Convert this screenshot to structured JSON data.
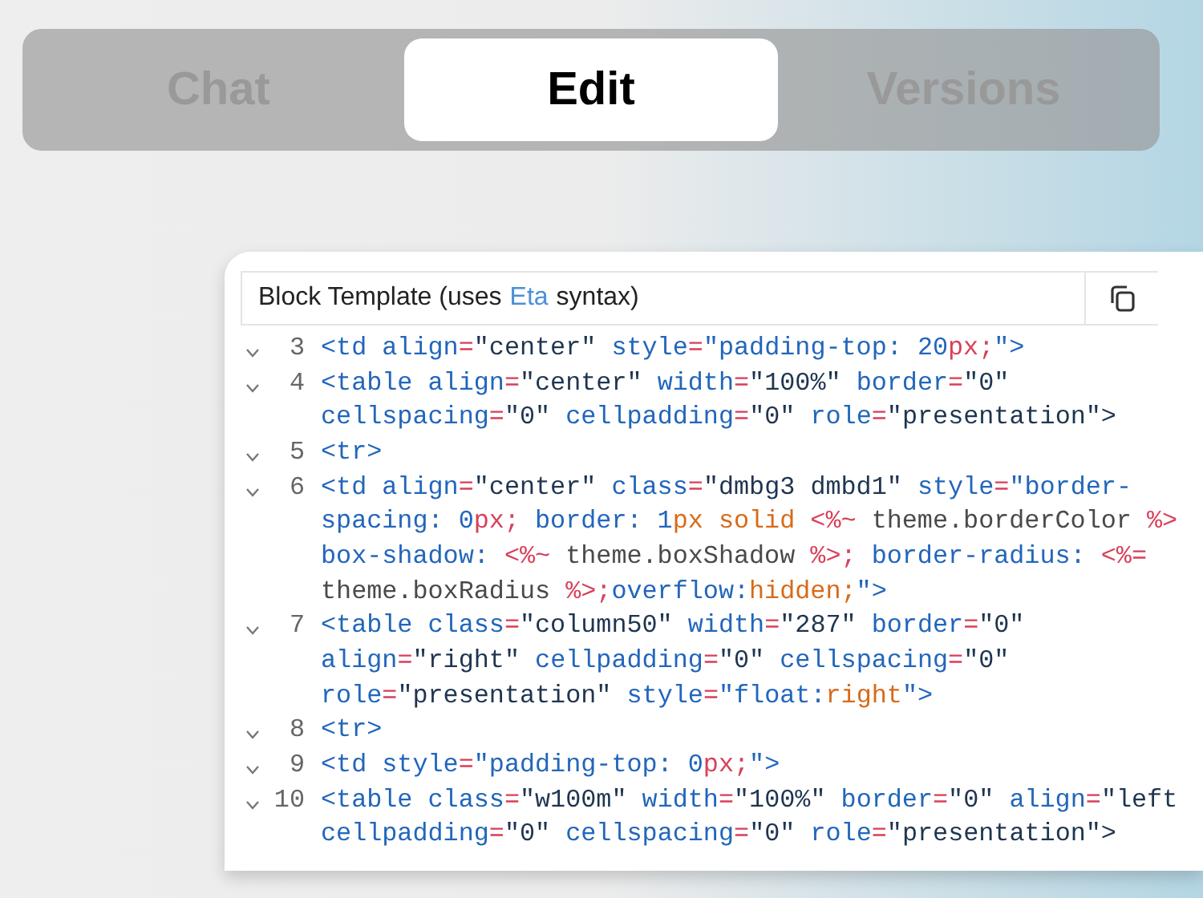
{
  "tabs": [
    {
      "label": "Chat",
      "selected": false
    },
    {
      "label": "Edit",
      "selected": true
    },
    {
      "label": "Versions",
      "selected": false
    }
  ],
  "editor": {
    "title_before": "Block Template (uses",
    "title_link": "Eta",
    "title_after": "syntax)",
    "lines": [
      {
        "number": "3",
        "collapsible": true,
        "rows": [
          {
            "segments": [
              {
                "kind": "b",
                "text": "<td align"
              },
              {
                "kind": "r",
                "text": "="
              },
              {
                "kind": "d",
                "text": "\"center\" "
              },
              {
                "kind": "b",
                "text": "style"
              },
              {
                "kind": "r",
                "text": "="
              },
              {
                "kind": "b",
                "text": "\"padding-top: 20"
              },
              {
                "kind": "r",
                "text": "px;"
              },
              {
                "kind": "b",
                "text": "\">"
              }
            ]
          }
        ]
      },
      {
        "number": "4",
        "collapsible": true,
        "rows": [
          {
            "segments": [
              {
                "kind": "b",
                "text": "<table align"
              },
              {
                "kind": "r",
                "text": "="
              },
              {
                "kind": "d",
                "text": "\"center\" "
              },
              {
                "kind": "b",
                "text": "width"
              },
              {
                "kind": "r",
                "text": "="
              },
              {
                "kind": "d",
                "text": "\"100%\" "
              },
              {
                "kind": "b",
                "text": "border"
              },
              {
                "kind": "r",
                "text": "="
              },
              {
                "kind": "d",
                "text": "\"0\""
              }
            ]
          },
          {
            "segments": [
              {
                "kind": "b",
                "text": "cellspacing"
              },
              {
                "kind": "r",
                "text": "="
              },
              {
                "kind": "d",
                "text": "\"0\" "
              },
              {
                "kind": "b",
                "text": "cellpadding"
              },
              {
                "kind": "r",
                "text": "="
              },
              {
                "kind": "d",
                "text": "\"0\" "
              },
              {
                "kind": "b",
                "text": "role"
              },
              {
                "kind": "r",
                "text": "="
              },
              {
                "kind": "d",
                "text": "\"presentation\">"
              }
            ]
          }
        ]
      },
      {
        "number": "5",
        "collapsible": true,
        "rows": [
          {
            "segments": [
              {
                "kind": "b",
                "text": "<tr>"
              }
            ]
          }
        ]
      },
      {
        "number": "6",
        "collapsible": true,
        "rows": [
          {
            "segments": [
              {
                "kind": "b",
                "text": "<td align"
              },
              {
                "kind": "r",
                "text": "="
              },
              {
                "kind": "d",
                "text": "\"center\" "
              },
              {
                "kind": "b",
                "text": "class"
              },
              {
                "kind": "r",
                "text": "="
              },
              {
                "kind": "d",
                "text": "\"dmbg3 dmbd1\" "
              },
              {
                "kind": "b",
                "text": "style"
              },
              {
                "kind": "r",
                "text": "="
              },
              {
                "kind": "b",
                "text": "\"border-"
              }
            ]
          },
          {
            "segments": [
              {
                "kind": "b",
                "text": "spacing: 0"
              },
              {
                "kind": "r",
                "text": "px; "
              },
              {
                "kind": "b",
                "text": "border: 1"
              },
              {
                "kind": "o",
                "text": "px solid "
              },
              {
                "kind": "r",
                "text": "<%~ "
              },
              {
                "kind": "g",
                "text": "theme.borderColor "
              },
              {
                "kind": "r",
                "text": "%>"
              }
            ]
          },
          {
            "segments": [
              {
                "kind": "b",
                "text": "box-shadow: "
              },
              {
                "kind": "r",
                "text": "<%~ "
              },
              {
                "kind": "g",
                "text": "theme.boxShadow "
              },
              {
                "kind": "r",
                "text": "%>; "
              },
              {
                "kind": "b",
                "text": "border-radius: "
              },
              {
                "kind": "r",
                "text": "<%="
              }
            ]
          },
          {
            "segments": [
              {
                "kind": "g",
                "text": "theme.boxRadius "
              },
              {
                "kind": "r",
                "text": "%>;"
              },
              {
                "kind": "b",
                "text": "overflow:"
              },
              {
                "kind": "o",
                "text": "hidden;"
              },
              {
                "kind": "b",
                "text": "\">"
              }
            ]
          }
        ]
      },
      {
        "number": "7",
        "collapsible": true,
        "rows": [
          {
            "segments": [
              {
                "kind": "b",
                "text": "<table class"
              },
              {
                "kind": "r",
                "text": "="
              },
              {
                "kind": "d",
                "text": "\"column50\" "
              },
              {
                "kind": "b",
                "text": "width"
              },
              {
                "kind": "r",
                "text": "="
              },
              {
                "kind": "d",
                "text": "\"287\" "
              },
              {
                "kind": "b",
                "text": "border"
              },
              {
                "kind": "r",
                "text": "="
              },
              {
                "kind": "d",
                "text": "\"0\""
              }
            ]
          },
          {
            "segments": [
              {
                "kind": "b",
                "text": "align"
              },
              {
                "kind": "r",
                "text": "="
              },
              {
                "kind": "d",
                "text": "\"right\" "
              },
              {
                "kind": "b",
                "text": "cellpadding"
              },
              {
                "kind": "r",
                "text": "="
              },
              {
                "kind": "d",
                "text": "\"0\" "
              },
              {
                "kind": "b",
                "text": "cellspacing"
              },
              {
                "kind": "r",
                "text": "="
              },
              {
                "kind": "d",
                "text": "\"0\""
              }
            ]
          },
          {
            "segments": [
              {
                "kind": "b",
                "text": "role"
              },
              {
                "kind": "r",
                "text": "="
              },
              {
                "kind": "d",
                "text": "\"presentation\" "
              },
              {
                "kind": "b",
                "text": "style"
              },
              {
                "kind": "r",
                "text": "="
              },
              {
                "kind": "b",
                "text": "\"float:"
              },
              {
                "kind": "o",
                "text": "right"
              },
              {
                "kind": "b",
                "text": "\">"
              }
            ]
          }
        ]
      },
      {
        "number": "8",
        "collapsible": true,
        "rows": [
          {
            "segments": [
              {
                "kind": "b",
                "text": "<tr>"
              }
            ]
          }
        ]
      },
      {
        "number": "9",
        "collapsible": true,
        "rows": [
          {
            "segments": [
              {
                "kind": "b",
                "text": "<td style"
              },
              {
                "kind": "r",
                "text": "="
              },
              {
                "kind": "b",
                "text": "\"padding-top: 0"
              },
              {
                "kind": "r",
                "text": "px;"
              },
              {
                "kind": "b",
                "text": "\">"
              }
            ]
          }
        ]
      },
      {
        "number": "10",
        "collapsible": true,
        "rows": [
          {
            "segments": [
              {
                "kind": "b",
                "text": "<table class"
              },
              {
                "kind": "r",
                "text": "="
              },
              {
                "kind": "d",
                "text": "\"w100m\" "
              },
              {
                "kind": "b",
                "text": "width"
              },
              {
                "kind": "r",
                "text": "="
              },
              {
                "kind": "d",
                "text": "\"100%\" "
              },
              {
                "kind": "b",
                "text": "border"
              },
              {
                "kind": "r",
                "text": "="
              },
              {
                "kind": "d",
                "text": "\"0\" "
              },
              {
                "kind": "b",
                "text": "align"
              },
              {
                "kind": "r",
                "text": "="
              },
              {
                "kind": "d",
                "text": "\"left"
              }
            ]
          },
          {
            "segments": [
              {
                "kind": "b",
                "text": "cellpadding"
              },
              {
                "kind": "r",
                "text": "="
              },
              {
                "kind": "d",
                "text": "\"0\" "
              },
              {
                "kind": "b",
                "text": "cellspacing"
              },
              {
                "kind": "r",
                "text": "="
              },
              {
                "kind": "d",
                "text": "\"0\" "
              },
              {
                "kind": "b",
                "text": "role"
              },
              {
                "kind": "r",
                "text": "="
              },
              {
                "kind": "d",
                "text": "\"presentation\">"
              }
            ]
          }
        ]
      }
    ]
  }
}
